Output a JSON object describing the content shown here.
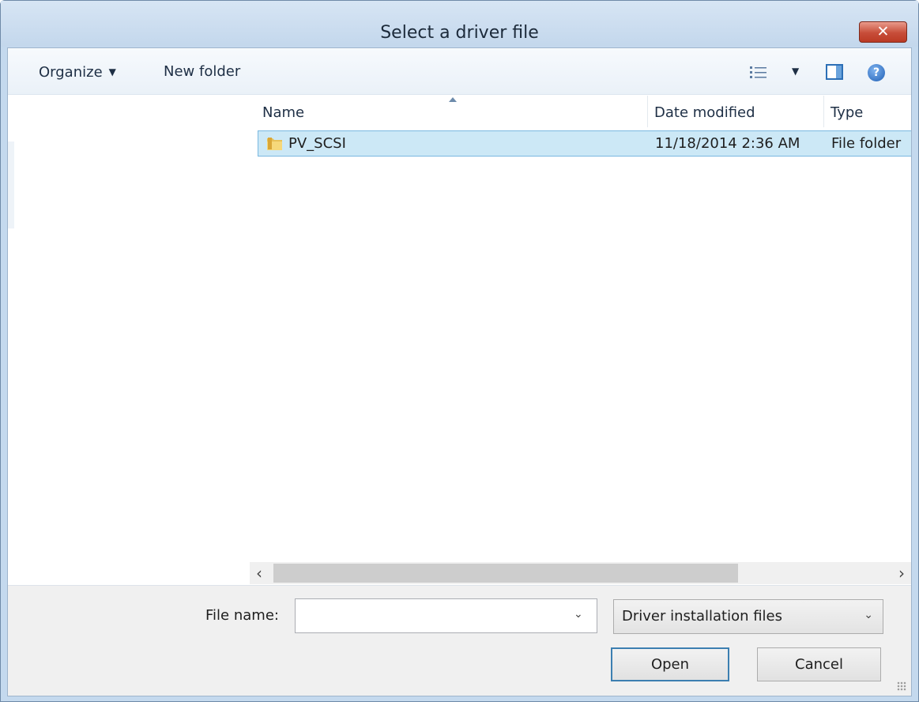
{
  "window": {
    "title": "Select a driver file",
    "close_glyph": "✕"
  },
  "toolbar": {
    "organize_label": "Organize",
    "new_folder_label": "New folder",
    "icons": [
      "view-details-icon",
      "preview-pane-icon",
      "help-icon"
    ]
  },
  "columns": {
    "name": "Name",
    "date_modified": "Date modified",
    "type": "Type"
  },
  "rows": [
    {
      "name": "PV_SCSI",
      "date_modified": "11/18/2014 2:36 AM",
      "type": "File folder",
      "icon": "folder-icon",
      "selected": true
    }
  ],
  "file_name": {
    "label": "File name:",
    "value": ""
  },
  "file_type": {
    "selected": "Driver installation files"
  },
  "buttons": {
    "open": "Open",
    "cancel": "Cancel"
  },
  "colors": {
    "selection": "#cce8f6",
    "selection_border": "#7ab8e0",
    "close_button": "#c74d39",
    "title_bar": "#c3d7ec"
  }
}
